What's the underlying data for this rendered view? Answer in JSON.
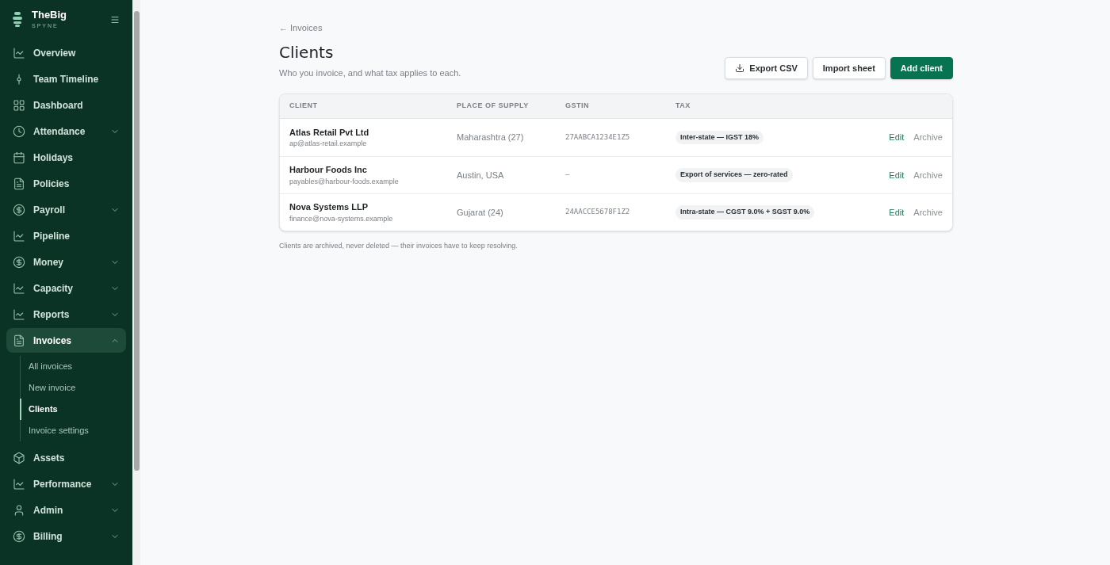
{
  "brand": {
    "name": "TheBig",
    "subtitle": "SPYNE"
  },
  "sidebar": {
    "items": [
      {
        "label": "Overview",
        "selected": false
      },
      {
        "label": "Team Timeline",
        "selected": false
      },
      {
        "label": "Dashboard",
        "selected": false
      },
      {
        "label": "Attendance",
        "selected": false,
        "expanded": false
      },
      {
        "label": "Holidays",
        "selected": false
      },
      {
        "label": "Policies",
        "selected": false
      },
      {
        "label": "Payroll",
        "selected": false,
        "expanded": false
      },
      {
        "label": "Pipeline",
        "selected": false
      },
      {
        "label": "Money",
        "selected": false,
        "expanded": false
      },
      {
        "label": "Capacity",
        "selected": false,
        "expanded": false
      },
      {
        "label": "Reports",
        "selected": false,
        "expanded": false
      },
      {
        "label": "Invoices",
        "selected": true,
        "expanded": true,
        "children": [
          {
            "label": "All invoices",
            "selected": false
          },
          {
            "label": "New invoice",
            "selected": false
          },
          {
            "label": "Clients",
            "selected": true
          },
          {
            "label": "Invoice settings",
            "selected": false
          }
        ]
      },
      {
        "label": "Assets",
        "selected": false
      },
      {
        "label": "Performance",
        "selected": false,
        "expanded": false
      },
      {
        "label": "Admin",
        "selected": false,
        "expanded": false
      },
      {
        "label": "Billing",
        "selected": false,
        "expanded": false
      }
    ]
  },
  "breadcrumb": "← Invoices",
  "title": "Clients",
  "subtitle": "Who you invoice, and what tax applies to each.",
  "buttons": [
    {
      "label": "Export CSV",
      "kind": "download"
    },
    {
      "label": "Import sheet",
      "kind": "secondary"
    },
    {
      "label": "Add client",
      "kind": "primary"
    }
  ],
  "table": {
    "columns": [
      "CLIENT",
      "PLACE OF SUPPLY",
      "GSTIN",
      "TAX"
    ],
    "rows": [
      {
        "name": "Atlas Retail Pvt Ltd",
        "email": "ap@atlas-retail.example",
        "place": "Maharashtra (27)",
        "gstin": "27AABCA1234E1Z5",
        "tax": "Inter-state — IGST 18%",
        "actions": [
          "Edit",
          "Archive"
        ]
      },
      {
        "name": "Harbour Foods Inc",
        "email": "payables@harbour-foods.example",
        "place": "Austin, USA",
        "gstin": "–",
        "tax": "Export of services — zero-rated",
        "actions": [
          "Edit",
          "Archive"
        ]
      },
      {
        "name": "Nova Systems LLP",
        "email": "finance@nova-systems.example",
        "place": "Gujarat (24)",
        "gstin": "24AACCE5678F1Z2",
        "tax": "Intra-state — CGST 9.0% + SGST 9.0%",
        "actions": [
          "Edit",
          "Archive"
        ]
      }
    ]
  },
  "footnote": "Clients are archived, never deleted — their invoices have to keep resolving."
}
